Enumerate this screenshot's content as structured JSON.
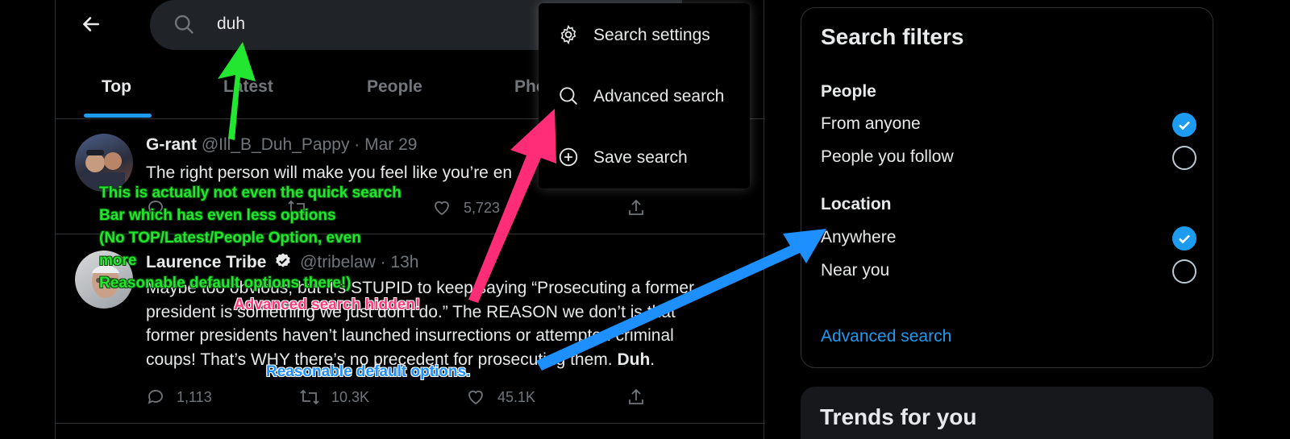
{
  "search": {
    "query": "duh"
  },
  "tabs": [
    {
      "label": "Top"
    },
    {
      "label": "Latest"
    },
    {
      "label": "People"
    },
    {
      "label": "Pho"
    }
  ],
  "search_menu": {
    "items": [
      {
        "label": "Search settings",
        "icon": "gear-icon"
      },
      {
        "label": "Advanced search",
        "icon": "search-icon"
      },
      {
        "label": "Save search",
        "icon": "plus-circle-icon"
      }
    ]
  },
  "tweets": [
    {
      "name": "G-rant",
      "handle": "@Ill_B_Duh_Pappy",
      "time": "· Mar 29",
      "text": "The right person will make you feel like you’re en",
      "likes": "5,723"
    },
    {
      "name": "Laurence Tribe",
      "handle": "@tribelaw",
      "time": "· 13h",
      "text_lines": [
        "Maybe too obvious, but it’s STUPID to keep saying “Prosecuting a former",
        "president is something we just don’t do.” The REASON we don’t is that",
        "former presidents haven’t launched insurrections or attempted criminal",
        "coups! That’s WHY there’s no precedent for prosecuting them."
      ],
      "text_bold_end": "Duh",
      "replies": "1,113",
      "retweets": "10.3K",
      "likes": "45.1K"
    }
  ],
  "filters": {
    "title": "Search filters",
    "people_heading": "People",
    "people_options": [
      {
        "label": "From anyone",
        "selected": true
      },
      {
        "label": "People you follow",
        "selected": false
      }
    ],
    "location_heading": "Location",
    "location_options": [
      {
        "label": "Anywhere",
        "selected": true
      },
      {
        "label": "Near you",
        "selected": false
      }
    ],
    "advanced_link": "Advanced search"
  },
  "trends": {
    "title": "Trends for you"
  },
  "annotations": {
    "green_lines": [
      "This is actually not even the quick search",
      "Bar which has even less options",
      "(No TOP/Latest/People Option, even",
      "more",
      "Reasonable default options there!)"
    ],
    "pink": "Advanced search hidden!",
    "blue": "Reasonable default options."
  },
  "colors": {
    "accent": "#1d9bf0",
    "green_annotation": "#22e62f",
    "pink_annotation": "#ff2d78",
    "blue_annotation": "#1d8fff"
  }
}
